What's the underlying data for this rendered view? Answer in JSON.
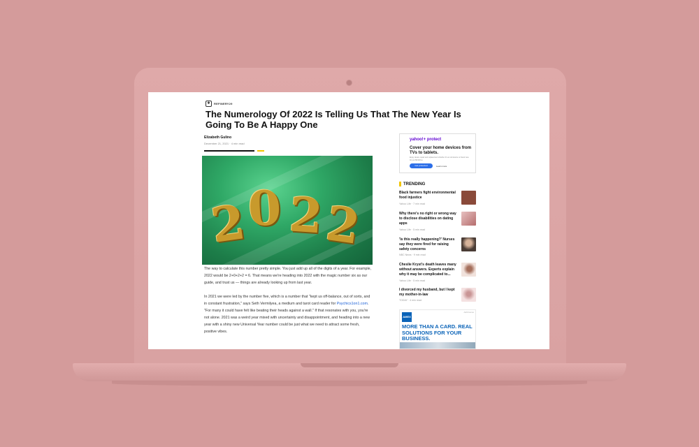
{
  "article": {
    "brand": "REFINERY29",
    "headline": "The Numerology Of 2022 Is Telling Us That The New Year Is Going To Be A Happy One",
    "author": "Elizabeth Gulino",
    "date": "December 21, 2021",
    "read_time": "4 min read",
    "hero_digits": [
      "2",
      "0",
      "2",
      "2"
    ],
    "p1": "The way to calculate this number pretty simple. You just add up all of the digits of a year. For example, 2022 would be 2+0+2+2 = 6. That means we're heading into 2022 with the magic number six as our guide, and trust us — things are already looking up from last year.",
    "p2_a": "In 2021 we were led by the number five, which is a number that \"kept us off-balance, out of sorts, and in constant frustration,\" says Seth Vermilyea, a medium and tarot card reader for ",
    "p2_link": "Psychics1on1.com",
    "p2_b": ". \"For many it could have felt like beating their heads against a wall.\" If that resonates with you, you're not alone. 2021 was a weird year mixed with uncertainty and disappointment, and heading into a new year with a shiny new Universal Year number could be just what we need to attract some fresh, positive vibes."
  },
  "ad_top": {
    "logo": "yahoo!+ protect",
    "title": "Cover your home devices from TVs to tablets.",
    "sub": "Enjoy device repair and replacement whether it's an old device or brand new for just $9.99/mo.",
    "button": "Get protected",
    "learn": "Learn more"
  },
  "trending": {
    "label": "TRENDING",
    "items": [
      {
        "title": "Black farmers fight environmental food injustice",
        "source": "Yahoo Life · 7 min read",
        "thumb_color": "#8a4a3a"
      },
      {
        "title": "Why there's no right or wrong way to disclose disabilities on dating apps",
        "source": "Yahoo Life · 5 min read",
        "thumb_color": "#c78a8a"
      },
      {
        "title": "'Is this really happening?' Nurses say they were fired for raising safety concerns",
        "source": "NBC News · 9 min read",
        "thumb_color": "#6b5a50"
      },
      {
        "title": "Cheslie Kryst's death leaves many without answers. Experts explain why it may be complicated to...",
        "source": "Yahoo Life · 5 min read",
        "thumb_color": "#d9b7b0"
      },
      {
        "title": "I divorced my husband, but I kept my mother-in-law",
        "source": "TODAY · 4 min read",
        "thumb_color": "#e6c2c2"
      }
    ]
  },
  "ad_bottom": {
    "logo": "AMEX",
    "tag": "AdChoices",
    "text": "MORE THAN A CARD. REAL SOLUTIONS FOR YOUR BUSINESS."
  }
}
